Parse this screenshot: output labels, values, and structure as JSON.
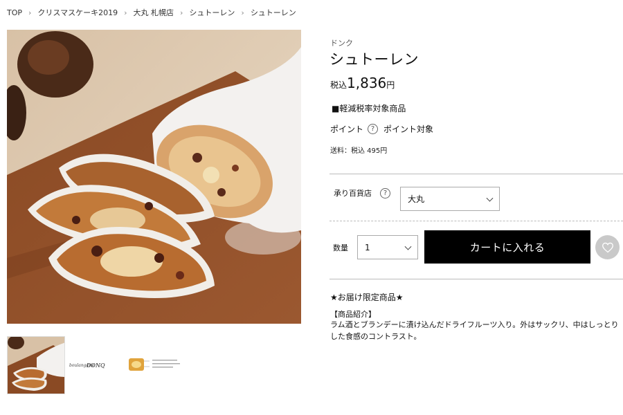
{
  "breadcrumb": {
    "items": [
      "TOP",
      "クリスマスケーキ2019",
      "大丸 札幌店",
      "シュトーレン",
      "シュトーレン"
    ],
    "separator": "›"
  },
  "product": {
    "brand": "ドンク",
    "title": "シュトーレン",
    "price_tax_label": "税込",
    "price_amount": "1,836",
    "price_unit": "円",
    "reduced_tax_note": "■軽減税率対象商品",
    "point_label": "ポイント",
    "point_help_icon": "?",
    "point_value": "ポイント対象",
    "shipping": "送料：税込 495円"
  },
  "purchase": {
    "store_label": "承り百貨店",
    "store_help_icon": "?",
    "store_selected": "大丸",
    "quantity_label": "数量",
    "quantity_selected": "1",
    "cart_button": "カートに入れる",
    "favorite_icon": "heart-icon"
  },
  "description": {
    "limited_title": "★お届け限定商品★",
    "section_heading": "【商品紹介】",
    "body": "ラム酒とブランデーに漬け込んだドライフルーツ入り。外はサックリ、中はしっとりした食感のコントラスト。"
  },
  "thumbnail_logo": {
    "boulangerie": "boulangerie",
    "brand_mark": "DONQ"
  },
  "colors": {
    "cart_button_bg": "#000000",
    "favorite_bg": "#c9c9c9",
    "divider": "#bbbbbb"
  }
}
